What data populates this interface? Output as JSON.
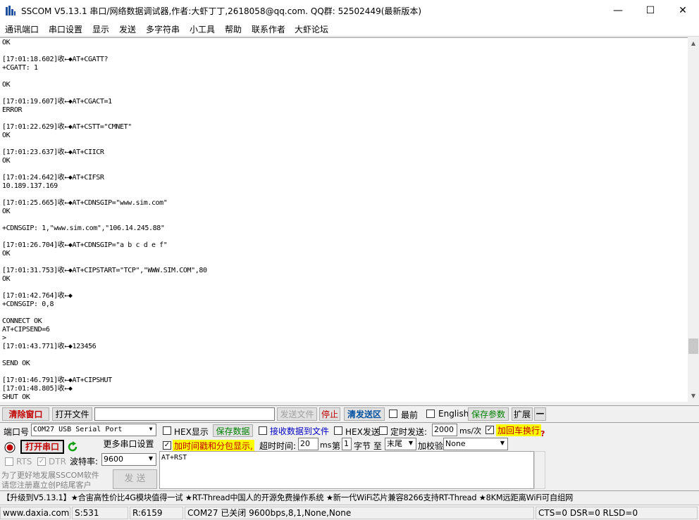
{
  "window": {
    "title": "SSCOM V5.13.1 串口/网络数据调试器,作者:大虾丁丁,2618058@qq.com. QQ群:  52502449(最新版本)",
    "minimize": "—",
    "maximize": "☐",
    "close": "✕"
  },
  "menu": [
    "通讯端口",
    "串口设置",
    "显示",
    "发送",
    "多字符串",
    "小工具",
    "帮助",
    "联系作者",
    "大虾论坛"
  ],
  "receive_log": "OK\n\n[17:01:18.602]收←◆AT+CGATT?\n+CGATT: 1\n\nOK\n\n[17:01:19.607]收←◆AT+CGACT=1\nERROR\n\n[17:01:22.629]收←◆AT+CSTT=\"CMNET\"\nOK\n\n[17:01:23.637]收←◆AT+CIICR\nOK\n\n[17:01:24.642]收←◆AT+CIFSR\n10.189.137.169\n\n[17:01:25.665]收←◆AT+CDNSGIP=\"www.sim.com\"\nOK\n\n+CDNSGIP: 1,\"www.sim.com\",\"106.14.245.88\"\n\n[17:01:26.704]收←◆AT+CDNSGIP=\"a b c d e f\"\nOK\n\n[17:01:31.753]收←◆AT+CIPSTART=\"TCP\",\"WWW.SIM.COM\",80\nOK\n\n[17:01:42.764]收←◆\n+CDNSGIP: 0,8\n\nCONNECT OK\nAT+CIPSEND=6\n>\n[17:01:43.771]收←◆123456\n\nSEND OK\n\n[17:01:46.791]收←◆AT+CIPSHUT\n[17:01:48.805]收←◆\nSHUT OK",
  "toolbar": {
    "clear_window": "清除窗口",
    "open_file": "打开文件",
    "file_path": "",
    "send_file": "发送文件",
    "stop": "停止",
    "clear_send": "清发送区",
    "topmost": "最前",
    "english": "English",
    "save_params": "保存参数",
    "expand": "扩展",
    "collapse": "—"
  },
  "port": {
    "port_label": "端口号",
    "port_value": "COM27 USB Serial Port",
    "open_port": "打开串口",
    "more_settings": "更多串口设置",
    "rts": "RTS",
    "dtr": "DTR",
    "baud_label": "波特率:",
    "baud_value": "9600",
    "promo_line1": "为了更好地发展SSCOM软件",
    "promo_line2": "请您注册嘉立创P结尾客户",
    "send_button": "发  送"
  },
  "options": {
    "hex_display": "HEX显示",
    "save_data": "保存数据",
    "recv_to_file": "接收数据到文件",
    "hex_send": "HEX发送",
    "timed_send": "定时发送:",
    "interval": "2000",
    "interval_unit": "ms/次",
    "add_crlf": "加回车换行",
    "timestamp": "加时间戳和分包显示,",
    "timeout_label": "超时时间:",
    "timeout_value": "20",
    "timeout_unit": "ms",
    "byte_prefix": "第",
    "byte_value": "1",
    "byte_suffix": "字节 至",
    "byte_end": "末尾",
    "checksum_label": "加校验",
    "checksum_value": "None"
  },
  "send_text": "AT+RST",
  "ticker": "【升级到V5.13.1】★合宙高性价比4G模块值得一试 ★RT-Thread中国人的开源免费操作系统 ★新一代WiFi芯片兼容8266支持RT-Thread ★8KM远距离WiFi可自组网",
  "status": {
    "website": "www.daxia.com",
    "sent": "S:531",
    "received": "R:6159",
    "port_state": "COM27 已关闭  9600bps,8,1,None,None",
    "lines": "CTS=0 DSR=0 RLSD=0"
  },
  "colors": {
    "accent_red": "#c00000",
    "accent_green": "#008000",
    "accent_blue": "#0000c0",
    "highlight_yellow": "#ffff00"
  }
}
